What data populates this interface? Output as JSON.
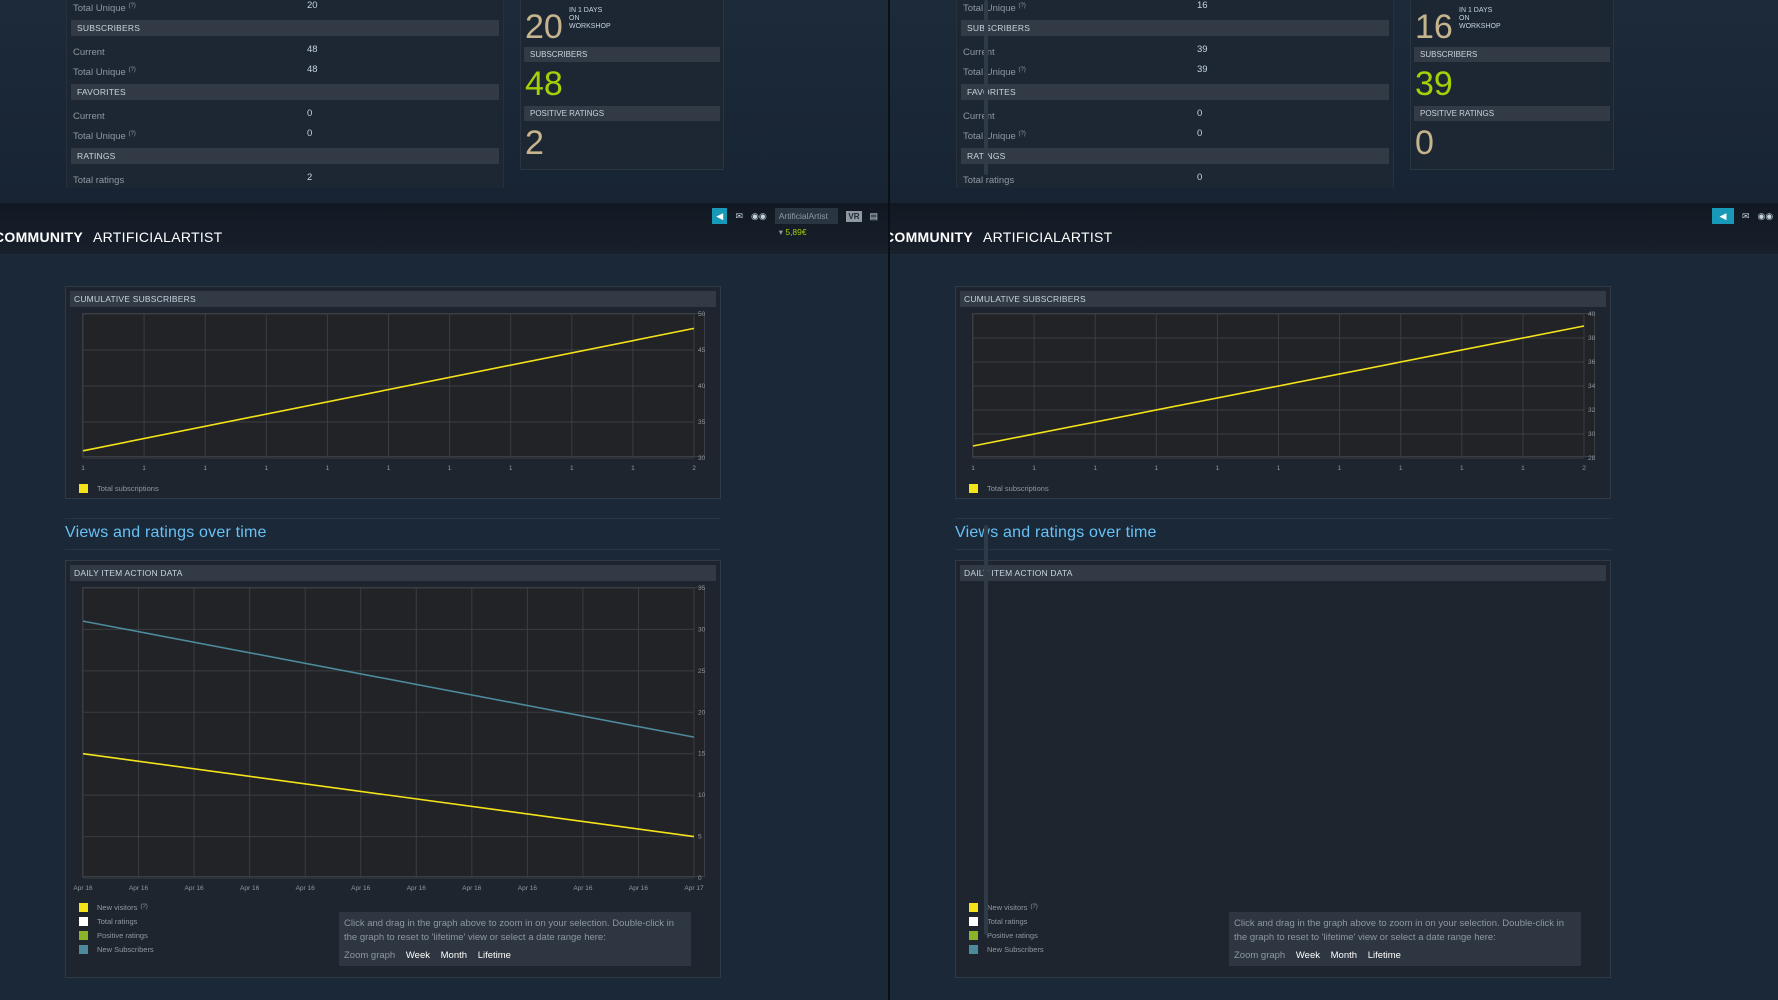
{
  "left": {
    "stats": {
      "top_row": {
        "label": "Total Unique",
        "q": "(?)",
        "value": "20"
      },
      "sections": [
        {
          "title": "SUBSCRIBERS",
          "rows": [
            {
              "label": "Current",
              "q": "",
              "value": "48"
            },
            {
              "label": "Total Unique",
              "q": "(?)",
              "value": "48"
            }
          ]
        },
        {
          "title": "FAVORITES",
          "rows": [
            {
              "label": "Current",
              "q": "",
              "value": "0"
            },
            {
              "label": "Total Unique",
              "q": "(?)",
              "value": "0"
            }
          ]
        },
        {
          "title": "RATINGS",
          "rows": [
            {
              "label": "Total ratings",
              "q": "",
              "value": "2"
            }
          ]
        }
      ]
    },
    "big": {
      "views_number": "20",
      "views_note": [
        "IN 1 DAYS",
        "ON",
        "WORKSHOP"
      ],
      "subscribers_title": "SUBSCRIBERS",
      "subscribers_number": "48",
      "ratings_title": "POSITIVE RATINGS",
      "ratings_number": "2"
    },
    "nav": {
      "community": "COMMUNITY",
      "user": "ARTIFICIALARTIST"
    },
    "titlebar": {
      "account": "ArtificialArtist",
      "balance": "5,89€",
      "vr": "VR"
    }
  },
  "right": {
    "stats": {
      "top_row": {
        "label": "Total Unique",
        "q": "(?)",
        "value": "16"
      },
      "sections": [
        {
          "title": "SUBSCRIBERS",
          "rows": [
            {
              "label": "Current",
              "q": "",
              "value": "39"
            },
            {
              "label": "Total Unique",
              "q": "(?)",
              "value": "39"
            }
          ]
        },
        {
          "title": "FAVORITES",
          "rows": [
            {
              "label": "Current",
              "q": "",
              "value": "0"
            },
            {
              "label": "Total Unique",
              "q": "(?)",
              "value": "0"
            }
          ]
        },
        {
          "title": "RATINGS",
          "rows": [
            {
              "label": "Total ratings",
              "q": "",
              "value": "0"
            }
          ]
        }
      ]
    },
    "big": {
      "views_number": "16",
      "views_note": [
        "IN 1 DAYS",
        "ON",
        "WORKSHOP"
      ],
      "subscribers_title": "SUBSCRIBERS",
      "subscribers_number": "39",
      "ratings_title": "POSITIVE RATINGS",
      "ratings_number": "0"
    },
    "nav": {
      "community": "COMMUNITY",
      "user": "ARTIFICIALARTIST"
    }
  },
  "section_heading": "Views and ratings over time",
  "cumulative_title": "CUMULATIVE SUBSCRIBERS",
  "daily_title": "DAILY ITEM ACTION DATA",
  "legend_cumulative": "Total subscriptions",
  "legend_daily": [
    {
      "label": "New visitors",
      "q": "(?)",
      "color": "#f5e31a"
    },
    {
      "label": "Total ratings",
      "q": "",
      "color": "#ffffff"
    },
    {
      "label": "Positive ratings",
      "q": "",
      "color": "#8cb42a"
    },
    {
      "label": "New Subscribers",
      "q": "",
      "color": "#4c8a9c"
    }
  ],
  "zoom": {
    "text": "Click and drag in the graph above to zoom in on your selection. Double-click in the graph to reset to 'lifetime' view or select a date range here:",
    "label": "Zoom graph",
    "week": "Week",
    "month": "Month",
    "lifetime": "Lifetime"
  },
  "colors": {
    "accent": "#67c1f5",
    "yellow": "#f5e31a",
    "teal": "#4c8a9c",
    "green": "#a4d007"
  },
  "chart_data": [
    {
      "type": "line",
      "title": "CUMULATIVE SUBSCRIBERS",
      "x_ticks": [
        "1",
        "1",
        "1",
        "1",
        "1",
        "1",
        "1",
        "1",
        "1",
        "1",
        "2"
      ],
      "y_ticks": [
        30,
        35,
        40,
        45,
        50
      ],
      "ylim": [
        30,
        50
      ],
      "series": [
        {
          "name": "Total subscriptions",
          "color": "#f5e31a",
          "x": [
            1,
            2
          ],
          "values": [
            31,
            48
          ]
        }
      ]
    },
    {
      "type": "line",
      "title": "DAILY ITEM ACTION DATA",
      "x_ticks": [
        "Apr 16",
        "Apr 16",
        "Apr 16",
        "Apr 16",
        "Apr 16",
        "Apr 16",
        "Apr 16",
        "Apr 16",
        "Apr 16",
        "Apr 16",
        "Apr 16",
        "Apr 17"
      ],
      "y_ticks": [
        0,
        5,
        10,
        15,
        20,
        25,
        30,
        35
      ],
      "ylim": [
        0,
        35
      ],
      "series": [
        {
          "name": "New visitors",
          "color": "#4c8a9c",
          "x": [
            "Apr 16",
            "Apr 17"
          ],
          "values": [
            31,
            17
          ]
        },
        {
          "name": "New Subscribers",
          "color": "#f5e31a",
          "x": [
            "Apr 16",
            "Apr 17"
          ],
          "values": [
            15,
            5
          ]
        }
      ]
    },
    {
      "type": "line",
      "title": "CUMULATIVE SUBSCRIBERS",
      "x_ticks": [
        "1",
        "1",
        "1",
        "1",
        "1",
        "1",
        "1",
        "1",
        "1",
        "1",
        "2"
      ],
      "y_ticks": [
        28,
        30,
        32,
        34,
        36,
        38,
        40
      ],
      "ylim": [
        28,
        40
      ],
      "series": [
        {
          "name": "Total subscriptions",
          "color": "#f5e31a",
          "x": [
            1,
            2
          ],
          "values": [
            29,
            39
          ]
        }
      ]
    }
  ]
}
